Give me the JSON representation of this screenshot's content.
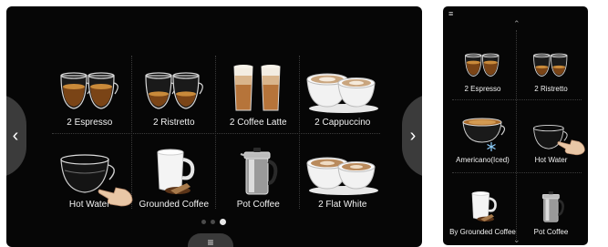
{
  "main_screen": {
    "nav_prev_icon": "chevron-left-icon",
    "nav_prev_glyph": "‹",
    "nav_next_icon": "chevron-right-icon",
    "nav_next_glyph": "›",
    "tiles": [
      {
        "label": "2 Espresso",
        "icon": "double-espresso-glass-icon"
      },
      {
        "label": "2 Ristretto",
        "icon": "double-ristretto-glass-icon"
      },
      {
        "label": "2 Coffee Latte",
        "icon": "double-latte-glass-icon"
      },
      {
        "label": "2 Cappuccino",
        "icon": "double-cappuccino-cup-icon"
      },
      {
        "label": "Hot Water",
        "icon": "hot-water-cup-icon"
      },
      {
        "label": "Grounded Coffee",
        "icon": "ground-coffee-mug-icon"
      },
      {
        "label": "Pot Coffee",
        "icon": "coffee-pot-icon"
      },
      {
        "label": "2 Flat White",
        "icon": "double-flat-white-cup-icon"
      }
    ],
    "page_indicator": {
      "pages": 3,
      "active": 3
    },
    "menu_glyph": "≡"
  },
  "side_screen": {
    "menu_glyph": "≡",
    "scroll_up_glyph": "⌃",
    "scroll_down_glyph": "⌄",
    "tiles": [
      {
        "label": "2 Espresso",
        "icon": "double-espresso-glass-icon"
      },
      {
        "label": "2 Ristretto",
        "icon": "double-ristretto-glass-icon"
      },
      {
        "label": "Americano(Iced)",
        "icon": "iced-americano-cup-icon"
      },
      {
        "label": "Hot Water",
        "icon": "hot-water-cup-icon"
      },
      {
        "label": "By Grounded Coffee",
        "icon": "ground-coffee-mug-icon"
      },
      {
        "label": "Pot Coffee",
        "icon": "coffee-pot-icon"
      }
    ]
  },
  "colors": {
    "screen_bg": "#060606",
    "nav_button": "#3b3b3b",
    "label_text": "#f2f2f2",
    "coffee": "#6b3a12",
    "crema": "#c98a3a"
  }
}
